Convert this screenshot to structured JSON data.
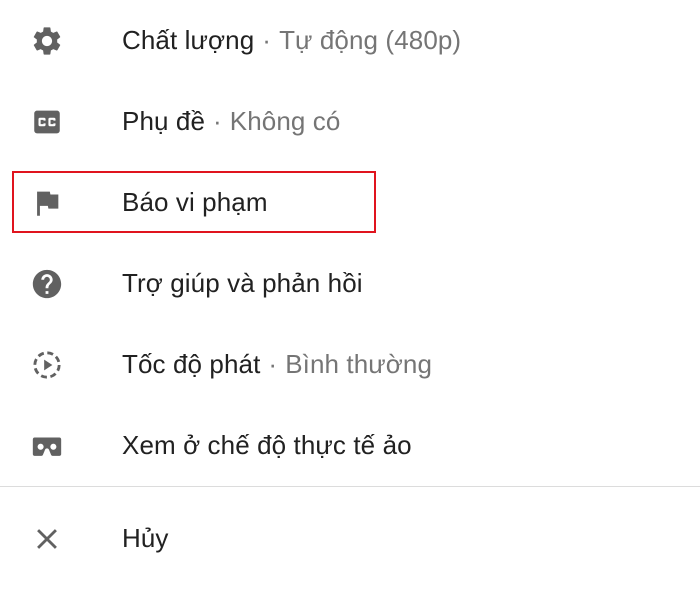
{
  "menu": {
    "items": [
      {
        "label": "Chất lượng",
        "separator": "·",
        "value": "Tự động (480p)",
        "icon": "gear-icon"
      },
      {
        "label": "Phụ đề",
        "separator": "·",
        "value": "Không có",
        "icon": "closed-captions-icon"
      },
      {
        "label": "Báo vi phạm",
        "icon": "flag-icon"
      },
      {
        "label": "Trợ giúp và phản hồi",
        "icon": "help-icon"
      },
      {
        "label": "Tốc độ phát",
        "separator": "·",
        "value": "Bình thường",
        "icon": "playback-speed-icon"
      },
      {
        "label": "Xem ở chế độ thực tế ảo",
        "icon": "vr-headset-icon"
      }
    ],
    "cancel": {
      "label": "Hủy",
      "icon": "close-icon"
    }
  },
  "colors": {
    "icon": "#616161",
    "text": "#212121",
    "secondary_text": "#757575",
    "highlight_border": "#e0141e",
    "divider": "#dcdcdc"
  }
}
